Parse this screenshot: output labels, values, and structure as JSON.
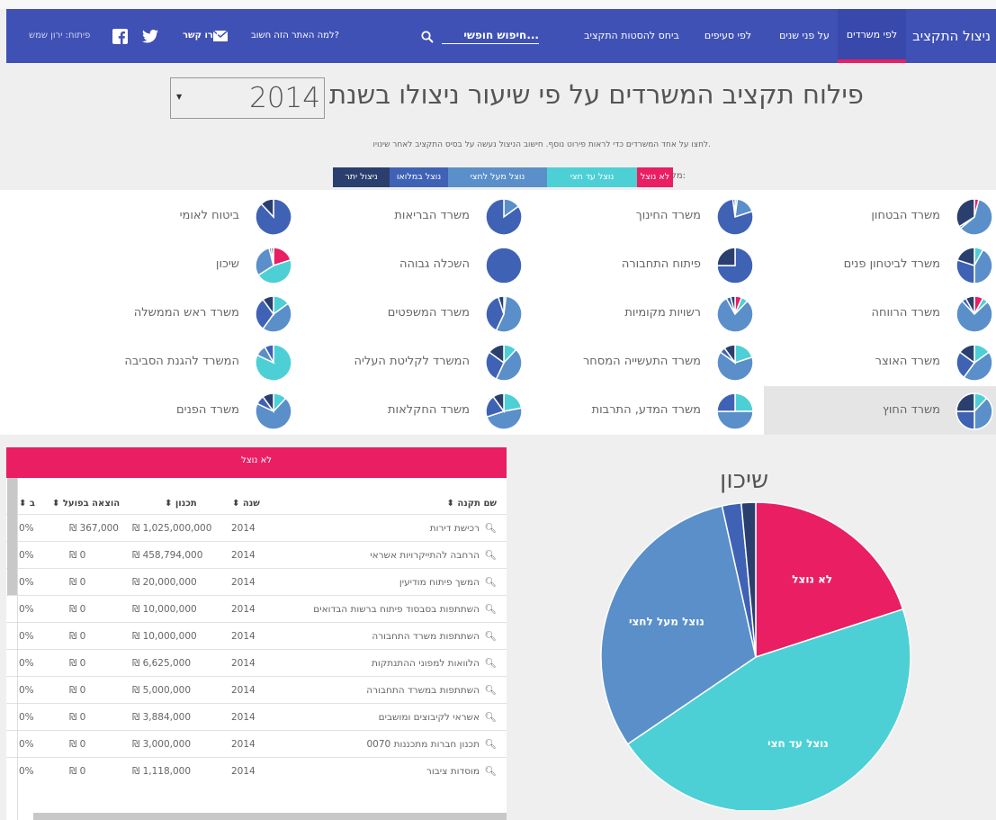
{
  "nav": {
    "brand": "ניצול התקציב",
    "tabs": [
      "לפי משרדים",
      "על פני שנים",
      "לפי סעיפים",
      "ביחס להסטות התקציב"
    ],
    "search_label": "חיפוש חופשי...",
    "why_link": "למה האתר הזה חשוב?",
    "contact_link": "צרו קשר",
    "credit": "פיתוח: ירון שמש"
  },
  "heading": {
    "title": "פילוח תקציב המשרדים על פי שיעור ניצולו בשנת",
    "year": "2014",
    "subtitle": "לחצו על אחד המשרדים כדי לראות פירוט נוסף. חישוב הניצול נעשה על בסיס התקציב לאחר שינויו."
  },
  "legend": {
    "label": "מקרא:",
    "items": [
      {
        "label": "לא נוצל",
        "color": "#e91e63"
      },
      {
        "label": "נוצל עד חצי",
        "color": "#4dd0d5"
      },
      {
        "label": "נוצל מעל לחצי",
        "color": "#5a8fca"
      },
      {
        "label": "נוצל במלואו",
        "color": "#3f62b5"
      },
      {
        "label": "ניצול יתר",
        "color": "#2a3f6e"
      }
    ]
  },
  "ministries": [
    {
      "name": "משרד הבטחון",
      "shares": [
        0.04,
        0.0,
        0.6,
        0.02,
        0.34
      ],
      "selected": false
    },
    {
      "name": "משרד החינוך",
      "shares": [
        0.0,
        0.02,
        0.18,
        0.78,
        0.02
      ],
      "selected": false
    },
    {
      "name": "משרד הבריאות",
      "shares": [
        0.0,
        0.0,
        0.15,
        0.85,
        0.0
      ],
      "selected": false
    },
    {
      "name": "ביטוח לאומי",
      "shares": [
        0.0,
        0.0,
        0.0,
        0.88,
        0.12
      ],
      "selected": false
    },
    {
      "name": "משרד לביטחון פנים",
      "shares": [
        0.0,
        0.08,
        0.42,
        0.3,
        0.2
      ],
      "selected": false
    },
    {
      "name": "פיתוח התחבורה",
      "shares": [
        0.0,
        0.0,
        0.0,
        0.75,
        0.25
      ],
      "selected": false
    },
    {
      "name": "השכלה גבוהה",
      "shares": [
        0.0,
        0.0,
        0.0,
        1.0,
        0.0
      ],
      "selected": false
    },
    {
      "name": "שיכון",
      "shares": [
        0.2,
        0.46,
        0.3,
        0.02,
        0.02
      ],
      "selected": false
    },
    {
      "name": "משרד הרווחה",
      "shares": [
        0.08,
        0.05,
        0.75,
        0.04,
        0.08
      ],
      "selected": false
    },
    {
      "name": "רשויות מקומיות",
      "shares": [
        0.06,
        0.06,
        0.8,
        0.04,
        0.04
      ],
      "selected": false
    },
    {
      "name": "משרד המשפטים",
      "shares": [
        0.0,
        0.02,
        0.55,
        0.38,
        0.05
      ],
      "selected": false
    },
    {
      "name": "משרד ראש הממשלה",
      "shares": [
        0.0,
        0.15,
        0.45,
        0.3,
        0.1
      ],
      "selected": false
    },
    {
      "name": "משרד האוצר",
      "shares": [
        0.0,
        0.15,
        0.45,
        0.25,
        0.15
      ],
      "selected": false
    },
    {
      "name": "משרד התעשייה המסחר",
      "shares": [
        0.0,
        0.2,
        0.65,
        0.05,
        0.1
      ],
      "selected": false
    },
    {
      "name": "המשרד לקליטת העליה",
      "shares": [
        0.0,
        0.12,
        0.45,
        0.28,
        0.15
      ],
      "selected": false
    },
    {
      "name": "המשרד להגנת הסביבה",
      "shares": [
        0.0,
        0.82,
        0.1,
        0.08,
        0.0
      ],
      "selected": false
    },
    {
      "name": "משרד החוץ",
      "shares": [
        0.0,
        0.12,
        0.38,
        0.25,
        0.25
      ],
      "selected": true
    },
    {
      "name": "משרד המדע, התרבות",
      "shares": [
        0.0,
        0.25,
        0.5,
        0.25,
        0.0
      ],
      "selected": false
    },
    {
      "name": "משרד החקלאות",
      "shares": [
        0.0,
        0.22,
        0.48,
        0.2,
        0.1
      ],
      "selected": false
    },
    {
      "name": "משרד הפנים",
      "shares": [
        0.0,
        0.12,
        0.7,
        0.08,
        0.1
      ],
      "selected": false
    }
  ],
  "table": {
    "header": "לא נוצל",
    "columns": [
      "שם תקנה",
      "שנה",
      "תכנון",
      "הוצאה בפועל",
      "ב"
    ],
    "rows": [
      {
        "name": "רכישת דירות",
        "year": "2014",
        "planned": "₪ 1,025,000,000",
        "actual": "₪ 367,000",
        "pct": "0%"
      },
      {
        "name": "הרחבה להתייקרויות אשראי",
        "year": "2014",
        "planned": "₪ 458,794,000",
        "actual": "₪ 0",
        "pct": "0%"
      },
      {
        "name": "המשך פיתוח מודיעין",
        "year": "2014",
        "planned": "₪ 20,000,000",
        "actual": "₪ 0",
        "pct": "0%"
      },
      {
        "name": "השתתפות בסבסוד פיתוח ברשות הבדואים",
        "year": "2014",
        "planned": "₪ 10,000,000",
        "actual": "₪ 0",
        "pct": "0%"
      },
      {
        "name": "השתתפות משרד התחבורה",
        "year": "2014",
        "planned": "₪ 10,000,000",
        "actual": "₪ 0",
        "pct": "0%"
      },
      {
        "name": "הלוואות למפוני ההתנתקות",
        "year": "2014",
        "planned": "₪ 6,625,000",
        "actual": "₪ 0",
        "pct": "0%"
      },
      {
        "name": "השתתפות במשרד התחבורה",
        "year": "2014",
        "planned": "₪ 5,000,000",
        "actual": "₪ 0",
        "pct": "0%"
      },
      {
        "name": "אשראי לקיבוצים ומושבים",
        "year": "2014",
        "planned": "₪ 3,884,000",
        "actual": "₪ 0",
        "pct": "0%"
      },
      {
        "name": "תכנון חברות מתכננות 0070",
        "year": "2014",
        "planned": "₪ 3,000,000",
        "actual": "₪ 0",
        "pct": "0%"
      },
      {
        "name": "מוסדות ציבור",
        "year": "2014",
        "planned": "₪ 1,118,000",
        "actual": "₪ 0",
        "pct": "0%"
      }
    ]
  },
  "chart_data": {
    "type": "pie",
    "title": "שיכון",
    "slices": [
      {
        "label": "לא נוצל",
        "value": 20,
        "color": "#e91e63"
      },
      {
        "label": "נוצל עד חצי",
        "value": 45.5,
        "color": "#4dd0d5"
      },
      {
        "label": "נוצל מעל לחצי",
        "value": 31,
        "color": "#5a8fca"
      },
      {
        "label": "נוצל במלואו",
        "value": 2,
        "color": "#3f62b5"
      },
      {
        "label": "ניצול יתר",
        "value": 1.5,
        "color": "#2a3f6e"
      }
    ]
  }
}
